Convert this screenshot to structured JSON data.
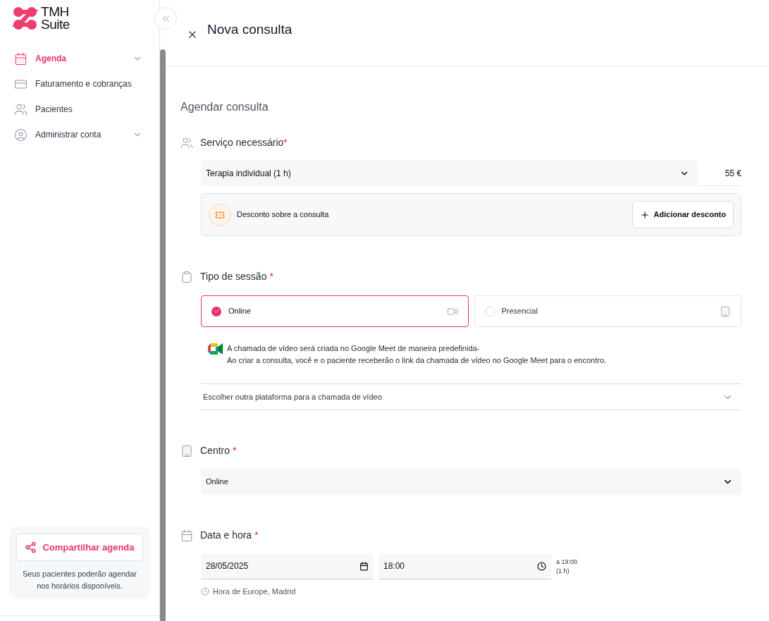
{
  "logo": {
    "line1": "TMH",
    "line2": "Suite"
  },
  "nav": [
    {
      "label": "Agenda",
      "selected": true,
      "kind": "calendar",
      "has_submenu": true
    },
    {
      "label": "Faturamento e cobranças",
      "selected": false,
      "kind": "card",
      "has_submenu": false
    },
    {
      "label": "Pacientes",
      "selected": false,
      "kind": "users",
      "has_submenu": false
    },
    {
      "label": "Administrar conta",
      "selected": false,
      "kind": "user",
      "has_submenu": true
    }
  ],
  "share": {
    "button": "Compartilhar agenda",
    "note": "Seus pacientes poderão agendar nos horários disponíveis."
  },
  "header": {
    "title": "Nova consulta"
  },
  "form": {
    "heading": "Agendar consulta",
    "service": {
      "label": "Serviço necessário",
      "required_mark": "*",
      "value": "Terapia individual (1 h)",
      "price": "55 €"
    },
    "discount": {
      "label": "Desconto sobre a consulta",
      "button": "Adicionar desconto"
    },
    "session": {
      "label": "Tipo de sessão",
      "required_mark": "*",
      "options": [
        {
          "label": "Online",
          "selected": true,
          "kind": "video"
        },
        {
          "label": "Presencial",
          "selected": false,
          "kind": "building"
        }
      ],
      "note_lines": [
        "A chamada de vídeo será criada no Google Meet de maneira predefinida-",
        "Ao criar a consulta, você e o paciente receberão o link da chamada de vídeo no Google Meet para o encontro."
      ],
      "other_platform": "Escolher outra plataforma para a chamada de vídeo"
    },
    "center": {
      "label": "Centro",
      "required_mark": "*",
      "value": "Online"
    },
    "datetime": {
      "label": "Data e hora",
      "required_mark": "*",
      "date": "28/05/2025",
      "time": "18:00",
      "end_time": "a 19:00",
      "duration": "(1 h)",
      "timezone": "Hora de Europe, Madrid"
    }
  }
}
